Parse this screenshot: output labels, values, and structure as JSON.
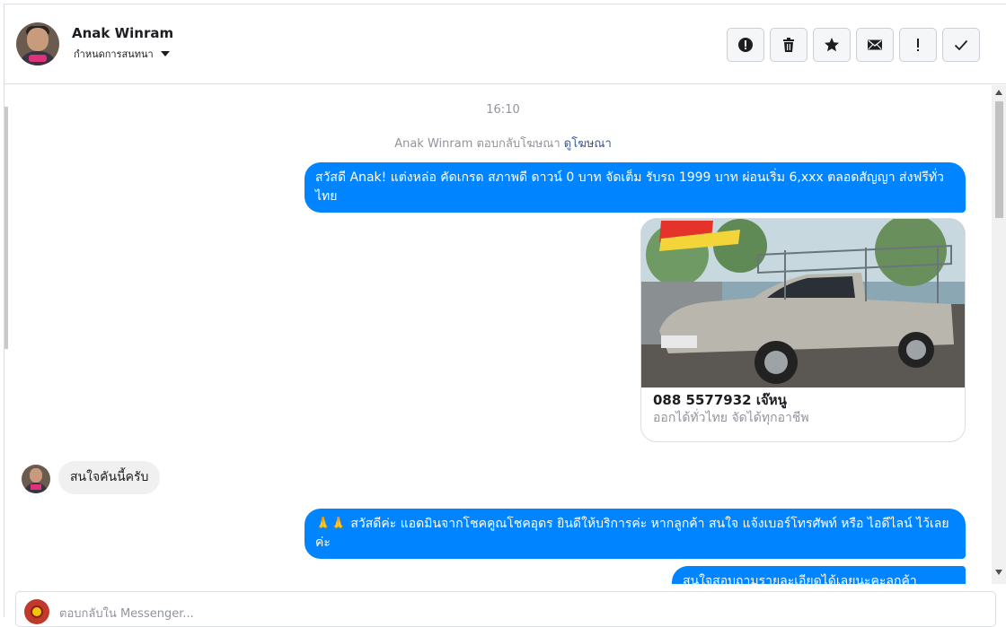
{
  "header": {
    "name": "Anak Winram",
    "assign_label": "กำหนดการสนทนา",
    "actions": [
      {
        "icon": "alert-circle-icon",
        "name": "mark-spam-button"
      },
      {
        "icon": "trash-icon",
        "name": "delete-button"
      },
      {
        "icon": "star-icon",
        "name": "star-button"
      },
      {
        "icon": "envelope-icon",
        "name": "mark-unread-button"
      },
      {
        "icon": "exclamation-icon",
        "name": "follow-up-button"
      },
      {
        "icon": "check-icon",
        "name": "mark-done-button"
      }
    ]
  },
  "thread": {
    "time": "16:10",
    "ad_reply_prefix": "Anak Winram ตอบกลับโฆษณา",
    "ad_reply_link": "ดูโฆษณา",
    "msg1": "สวัสดี Anak! แต่งหล่อ คัดเกรด สภาพดี ดาวน์ 0 บาท จัดเต็ม รับรถ 1999 บาท ผ่อนเริ่ม 6,xxx ตลอดสัญญา ส่งฟรีทั่วไทย",
    "card": {
      "title": "088 5577932 เจ๊หนู",
      "description": "ออกได้ทั่วไทย จัดได้ทุกอาชีพ"
    },
    "incoming": "สนใจคันนี้ครับ",
    "msg2": "🙏🙏 สวัสดีค่ะ แอดมินจากโชคคูณโชคอุดร ยินดีให้บริการค่ะ หากลูกค้า สนใจ แจ้งเบอร์โทรศัพท์ หรือ ไอดีไลน์ ไว้เลยค่ะ",
    "msg3": "สนใจสอบถามรายละเอียดได้เลยนะคะลูกค้า"
  },
  "composer": {
    "placeholder": "ตอบกลับใน Messenger..."
  },
  "colors": {
    "outgoing_bubble": "#0084ff",
    "incoming_bubble": "#f1f0f0",
    "link": "#385898"
  }
}
